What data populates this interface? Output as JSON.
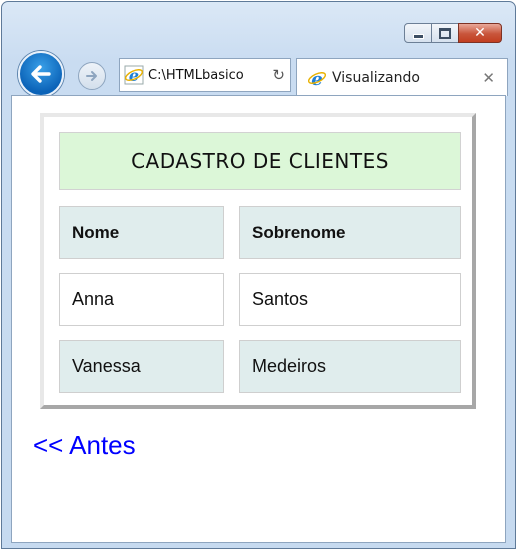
{
  "window": {
    "controls": [
      "minimize",
      "maximize",
      "close"
    ]
  },
  "toolbar": {
    "address": "C:\\HTMLbasico",
    "tab_title": "Visualizando",
    "icons": [
      "back-arrow",
      "forward-arrow",
      "ie-logo",
      "refresh",
      "tab-close"
    ]
  },
  "table": {
    "title": "CADASTRO DE CLIENTES",
    "headers": [
      "Nome",
      "Sobrenome"
    ],
    "rows": [
      [
        "Anna",
        "Santos"
      ],
      [
        "Vanessa",
        "Medeiros"
      ]
    ]
  },
  "link": {
    "label": "<< Antes"
  },
  "colors": {
    "title_bg": "#dcf7d8",
    "shaded_cell_bg": "#e0eded",
    "link": "#0000ff",
    "back_button": "#0b63b8"
  }
}
